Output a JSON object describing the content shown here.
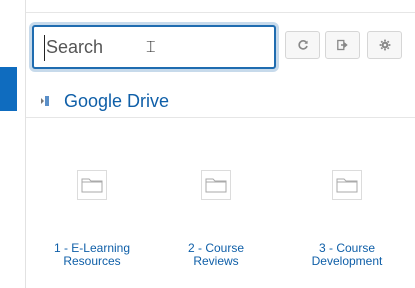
{
  "search": {
    "placeholder": "Search",
    "value": ""
  },
  "toolbar": {
    "refresh_icon": "refresh-icon",
    "logout_icon": "logout-icon",
    "settings_icon": "gear-icon"
  },
  "repository": {
    "title": "Google Drive"
  },
  "folders": [
    {
      "label_line1": "1 - E-Learning",
      "label_line2": "Resources"
    },
    {
      "label_line1": "2 - Course",
      "label_line2": "Reviews"
    },
    {
      "label_line1": "3 - Course",
      "label_line2": "Development"
    }
  ],
  "colors": {
    "accent": "#0f6cbf",
    "link": "#0f5fa8",
    "focus_border": "#1f6cb0"
  }
}
